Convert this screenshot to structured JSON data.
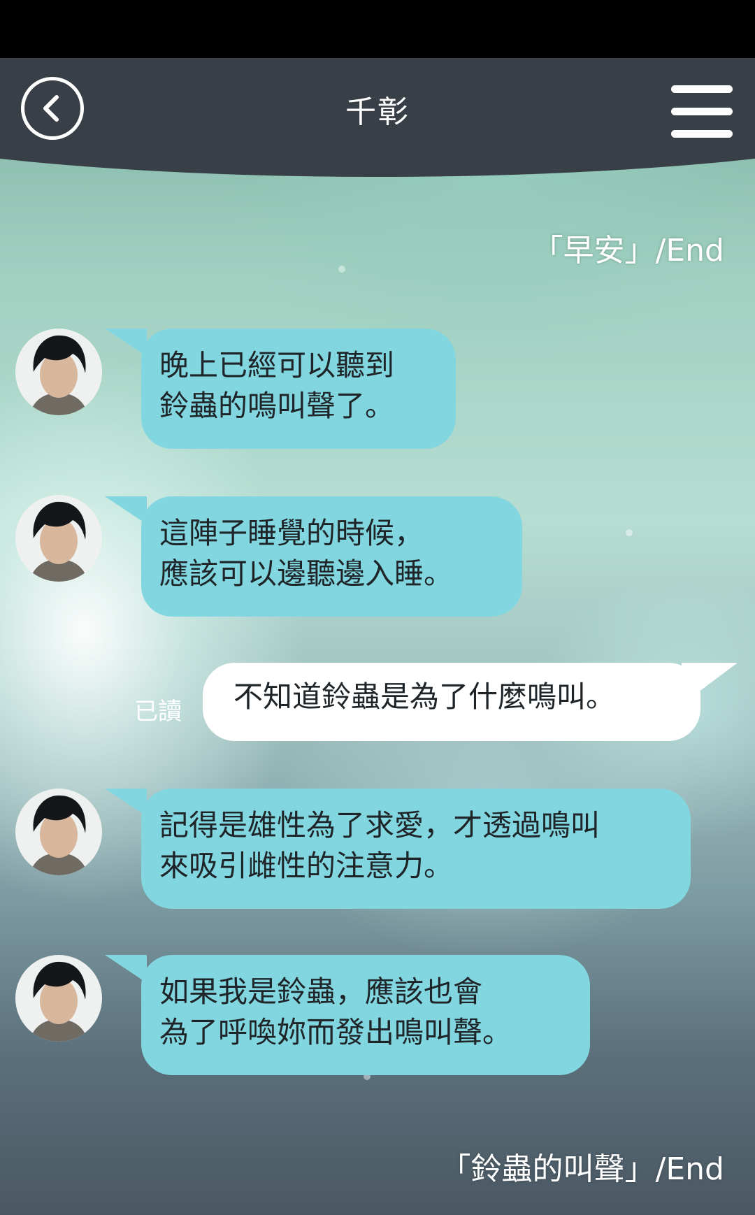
{
  "header": {
    "title": "千彰",
    "back_icon": "chevron-left-icon",
    "menu_icon": "hamburger-menu-icon"
  },
  "chat": {
    "end_label_top": "「早安」/End",
    "messages": [
      {
        "sender": "other",
        "text": "晚上已經可以聽到\n鈴蟲的鳴叫聲了。"
      },
      {
        "sender": "other",
        "text": "這陣子睡覺的時候，\n應該可以邊聽邊入睡。"
      },
      {
        "sender": "me",
        "text": "不知道鈴蟲是為了什麼鳴叫。",
        "read_label": "已讀"
      },
      {
        "sender": "other",
        "text": "記得是雄性為了求愛，才透過鳴叫\n來吸引雌性的注意力。"
      },
      {
        "sender": "other",
        "text": "如果我是鈴蟲，應該也會\n為了呼喚妳而發出鳴叫聲。"
      }
    ],
    "end_label_bottom": "「鈴蟲的叫聲」/End"
  },
  "colors": {
    "header_bg": "#393f47",
    "other_bubble": "#82d6df",
    "my_bubble": "#ffffff",
    "status_bar": "#000000"
  }
}
